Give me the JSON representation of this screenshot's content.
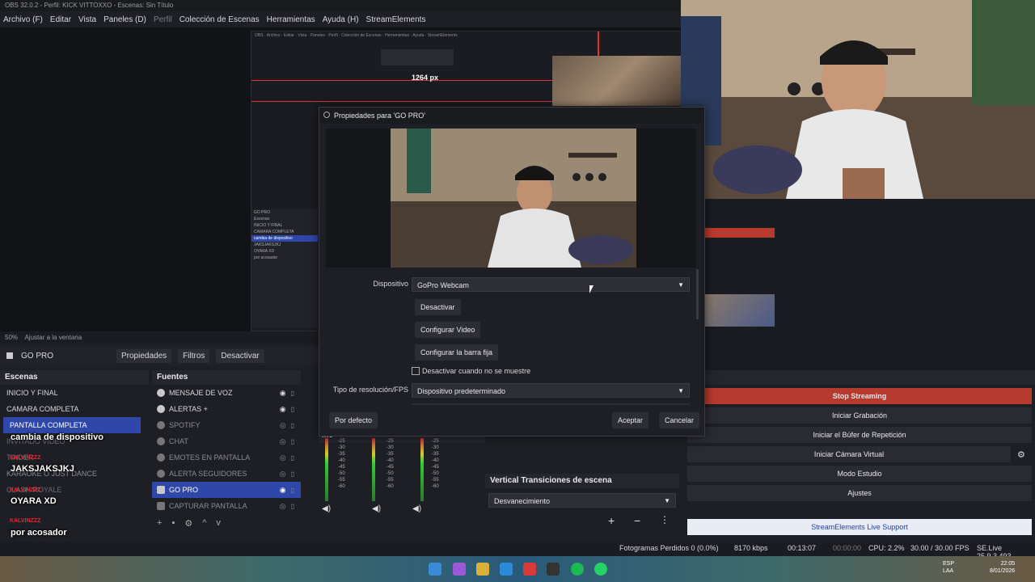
{
  "window": {
    "title": "OBS 32.0.2 - Perfil: KICK VITTOXXO - Escenas: Sin Título"
  },
  "menu": [
    "Archivo (F)",
    "Editar",
    "Vista",
    "Paneles (D)",
    "Perfil",
    "Colección de Escenas",
    "Herramientas",
    "Ayuda (H)",
    "StreamElements"
  ],
  "nested": {
    "px_label": "1264 px",
    "overlay": "cambia de dispositivo",
    "item": "GO PRO"
  },
  "preview": {
    "zoom": "50%",
    "fit": "Ajustar a la ventana"
  },
  "source_toolbar": {
    "source": "GO PRO",
    "properties": "Propiedades",
    "filters": "Filtros",
    "deactivate": "Desactivar"
  },
  "scenes": {
    "title": "Escenas",
    "items": [
      "INICIO Y FINAL",
      "CAMARA COMPLETA",
      "PANTALLA COMPLETA",
      "INVITADO VIDEO",
      "TINDER",
      "KARAOKE O JUST DANCE",
      "CLASH ROYALE"
    ]
  },
  "overlays": {
    "o1": "cambia de dispositivo",
    "o2": "JAKSJAKSJKJ",
    "o3": "OYARA XD",
    "o4": "por acosador",
    "small": "KALVINZZZ"
  },
  "sources": {
    "title": "Fuentes",
    "items": [
      "MENSAJE DE VOZ",
      "ALERTAS +",
      "SPOTIFY",
      "CHAT",
      "EMOTES EN PANTALLA",
      "ALERTA SEGUIDORES",
      "GO PRO",
      "CAPTURAR PANTALLA"
    ]
  },
  "mixer": {
    "title": "Me",
    "ticks": [
      "-25",
      "-30",
      "-35",
      "-40",
      "-45",
      "-50",
      "-55",
      "-60"
    ]
  },
  "transitions": {
    "title": "Vertical Transiciones de escena",
    "selected": "Desvanecimiento"
  },
  "controls": {
    "title": "les",
    "buttons": [
      "Stop Streaming",
      "Iniciar Grabación",
      "Iniciar el Búfer de Repetición",
      "Iniciar Cámara Virtual",
      "Modo Estudio",
      "Ajustes"
    ],
    "se": "StreamElements Live Support"
  },
  "dialog": {
    "title": "Propiedades para 'GO PRO'",
    "device_label": "Dispositivo",
    "device_value": "GoPro Webcam",
    "btn_deactivate": "Desactivar",
    "btn_config_video": "Configurar Video",
    "btn_config_bar": "Configurar la barra fija",
    "checkbox_label": "Desactivar cuando no se muestre",
    "res_label": "Tipo de resolución/FPS",
    "res_value": "Dispositivo predeterminado",
    "btn_default": "Por defecto",
    "btn_accept": "Aceptar",
    "btn_cancel": "Cancelar"
  },
  "status": {
    "dropped": "Fotogramas Perdidos 0 (0.0%)",
    "kbps": "8170 kbps",
    "stream_time": "00:13:07",
    "rec_time": "00:00:00",
    "cpu": "CPU: 2.2%",
    "fps": "30.00 / 30.00 FPS",
    "version": "SE.Live 25.9.3.493"
  },
  "taskbar": {
    "lang": "ESP",
    "lang2": "LAA",
    "time": "22:05",
    "date": "8/01/2026"
  }
}
